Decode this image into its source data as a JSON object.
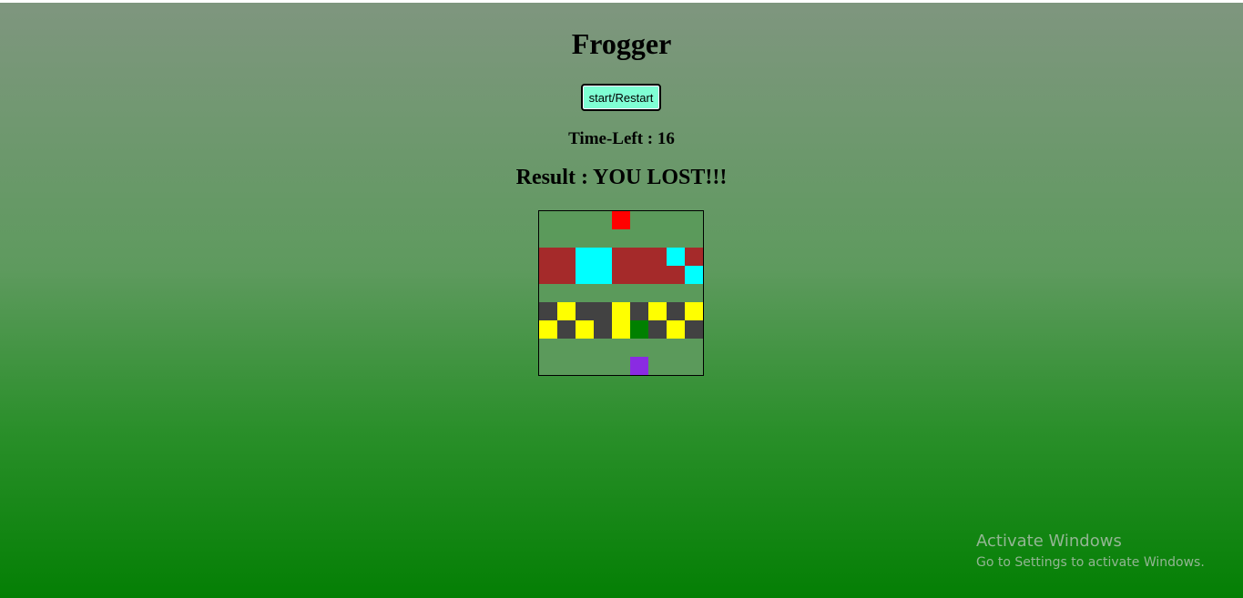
{
  "game": {
    "title": "Frogger",
    "button_label": "start/Restart",
    "time_left_text": "Time-Left : 16",
    "result_text": "Result : YOU LOST!!!"
  },
  "colors": {
    "E": "#5b9a5b",
    "F": "#ff0000",
    "R": "#a52a2a",
    "C": "#00ffff",
    "D": "#424242",
    "Y": "#ffff00",
    "G": "#008000",
    "P": "#8a2be2"
  },
  "legend": {
    "F": "ending-block",
    "R": "log-right",
    "C": "water",
    "D": "road",
    "Y": "car",
    "G": "frog",
    "P": "starting-block",
    "E": "grass"
  },
  "board": [
    [
      "E",
      "E",
      "E",
      "E",
      "F",
      "E",
      "E",
      "E",
      "E"
    ],
    [
      "E",
      "E",
      "E",
      "E",
      "E",
      "E",
      "E",
      "E",
      "E"
    ],
    [
      "R",
      "R",
      "C",
      "C",
      "R",
      "R",
      "R",
      "C",
      "R"
    ],
    [
      "R",
      "R",
      "C",
      "C",
      "R",
      "R",
      "R",
      "R",
      "C"
    ],
    [
      "E",
      "E",
      "E",
      "E",
      "E",
      "E",
      "E",
      "E",
      "E"
    ],
    [
      "D",
      "Y",
      "D",
      "D",
      "Y",
      "D",
      "Y",
      "D",
      "Y"
    ],
    [
      "Y",
      "D",
      "Y",
      "D",
      "Y",
      "G",
      "D",
      "Y",
      "D"
    ],
    [
      "E",
      "E",
      "E",
      "E",
      "E",
      "E",
      "E",
      "E",
      "E"
    ],
    [
      "E",
      "E",
      "E",
      "E",
      "E",
      "P",
      "E",
      "E",
      "E"
    ]
  ],
  "watermark": {
    "title": "Activate Windows",
    "subtitle": "Go to Settings to activate Windows."
  }
}
